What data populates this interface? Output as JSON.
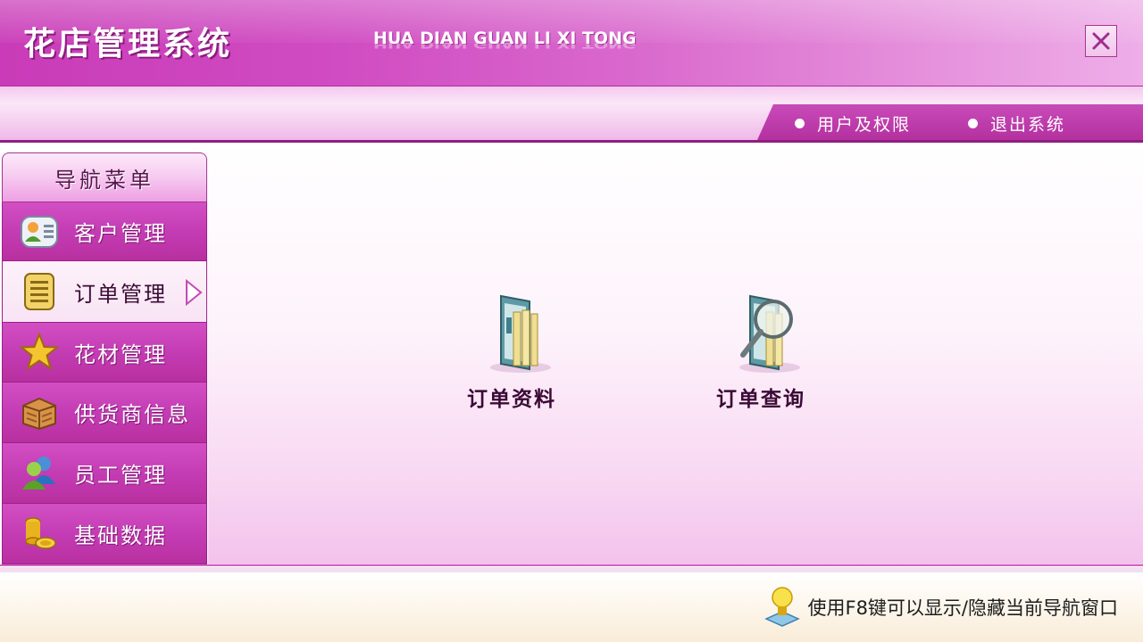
{
  "header": {
    "title": "花店管理系统",
    "subtitle": "HUA DIAN GUAN LI XI TONG",
    "close_icon": "close-icon"
  },
  "topnav": {
    "items": [
      {
        "label": "用户及权限",
        "icon": "bullet-dot-icon"
      },
      {
        "label": "退出系统",
        "icon": "bullet-dot-icon"
      }
    ]
  },
  "sidebar": {
    "header": "导航菜单",
    "items": [
      {
        "label": "客户管理",
        "icon": "contact-card-icon",
        "active": false
      },
      {
        "label": "订单管理",
        "icon": "document-list-icon",
        "active": true
      },
      {
        "label": "花材管理",
        "icon": "star-icon",
        "active": false
      },
      {
        "label": "供货商信息",
        "icon": "crate-icon",
        "active": false
      },
      {
        "label": "员工管理",
        "icon": "users-icon",
        "active": false
      },
      {
        "label": "基础数据",
        "icon": "coins-icon",
        "active": false
      }
    ]
  },
  "main": {
    "tiles": [
      {
        "label": "订单资料",
        "icon": "folder-documents-icon"
      },
      {
        "label": "订单查询",
        "icon": "folder-search-icon"
      }
    ]
  },
  "footer": {
    "hint": "使用F8键可以显示/隐藏当前导航窗口",
    "icon": "lightbulb-icon"
  },
  "colors": {
    "accent": "#c43cb4",
    "header_light": "#eeaee8",
    "footer_bg": "#fdf8ef"
  }
}
